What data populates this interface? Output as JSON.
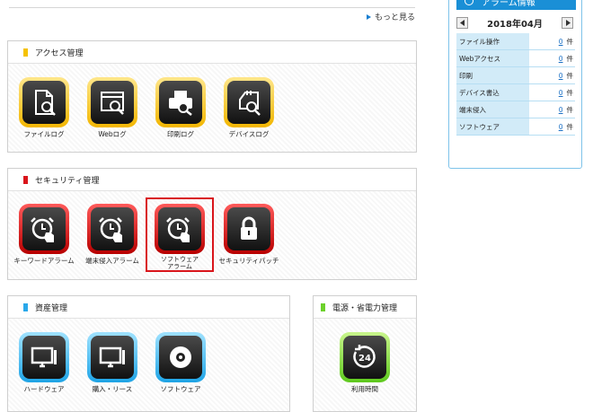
{
  "more_link": "もっと見る",
  "sections": {
    "access": {
      "title": "アクセス管理",
      "items": [
        {
          "label": "ファイルログ",
          "icon": "file-log-icon"
        },
        {
          "label": "Webログ",
          "icon": "web-log-icon"
        },
        {
          "label": "印刷ログ",
          "icon": "print-log-icon"
        },
        {
          "label": "デバイスログ",
          "icon": "device-log-icon"
        }
      ]
    },
    "security": {
      "title": "セキュリティ管理",
      "items": [
        {
          "label": "キーワードアラーム",
          "icon": "alarm-clock-icon"
        },
        {
          "label": "端末侵入アラーム",
          "icon": "alarm-clock-icon"
        },
        {
          "label": "ソフトウェア\nアラーム",
          "icon": "alarm-clock-icon",
          "selected": true
        },
        {
          "label": "セキュリティパッチ",
          "icon": "lock-icon"
        }
      ]
    },
    "assets": {
      "title": "資産管理",
      "items": [
        {
          "label": "ハードウェア",
          "icon": "desktop-pc-icon"
        },
        {
          "label": "購入・リース",
          "icon": "desktop-pc-icon"
        },
        {
          "label": "ソフトウェア",
          "icon": "disc-icon"
        }
      ]
    },
    "power": {
      "title": "電源・省電力管理",
      "items": [
        {
          "label": "利用時間",
          "icon": "24h-clock-icon"
        }
      ]
    }
  },
  "alarm_panel": {
    "title": "アラーム情報",
    "month": "2018年04月",
    "unit": "件",
    "rows": [
      {
        "label": "ファイル操作",
        "count": "0"
      },
      {
        "label": "Webアクセス",
        "count": "0"
      },
      {
        "label": "印刷",
        "count": "0"
      },
      {
        "label": "デバイス書込",
        "count": "0"
      },
      {
        "label": "端末侵入",
        "count": "0"
      },
      {
        "label": "ソフトウェア",
        "count": "0"
      }
    ]
  },
  "colors": {
    "access": "#f5c200",
    "security": "#d9151b",
    "assets": "#2aa8ea",
    "power": "#6cd12b",
    "alarm_header": "#1a8fd6"
  }
}
